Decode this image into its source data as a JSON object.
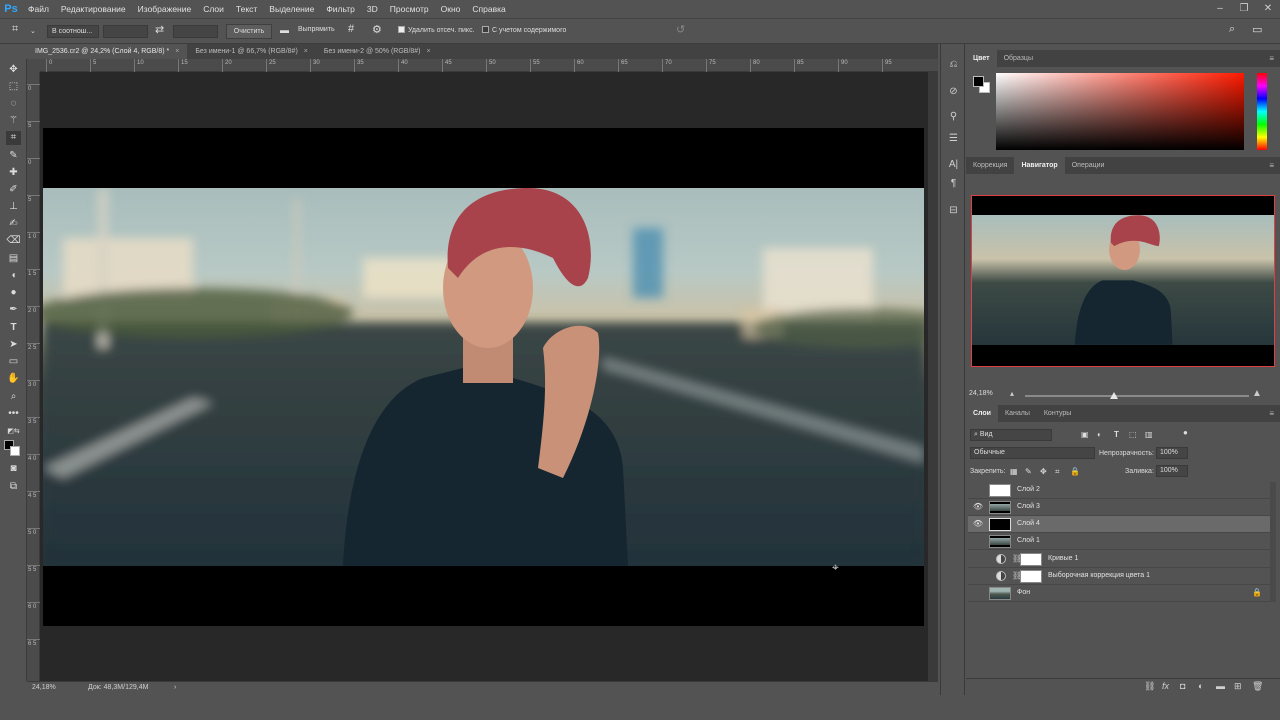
{
  "app": {
    "logo": "Ps"
  },
  "menu": [
    "Файл",
    "Редактирование",
    "Изображение",
    "Слои",
    "Текст",
    "Выделение",
    "Фильтр",
    "3D",
    "Просмотр",
    "Окно",
    "Справка"
  ],
  "options": {
    "ratio_select": "В соотнош...",
    "clear_label": "Очистить",
    "straighten_label": "Выпрямить",
    "delete_cropped_label": "Удалить отсеч. пикс.",
    "content_aware_label": "С учетом содержимого"
  },
  "tabs": [
    {
      "label": "IMG_2536.cr2 @ 24,2% (Слой 4, RGB/8) *",
      "close": "×"
    },
    {
      "label": "Без имени-1 @ 66,7% (RGB/8#)",
      "close": "×"
    },
    {
      "label": "Без имени-2 @ 50% (RGB/8#)",
      "close": "×"
    }
  ],
  "ruler_h": [
    "0",
    "5",
    "10",
    "15",
    "20",
    "25",
    "30",
    "35",
    "40",
    "45",
    "50",
    "55",
    "60",
    "65",
    "70",
    "75",
    "80",
    "85",
    "90",
    "95"
  ],
  "ruler_v": [
    "0",
    "5",
    "0",
    "5",
    "1 0",
    "1 5",
    "2 0",
    "2 5",
    "3 0",
    "3 5",
    "4 0",
    "4 5",
    "5 0",
    "5 5",
    "6 0",
    "6 5"
  ],
  "status": {
    "zoom": "24,18%",
    "doc": "Док: 48,3M/129,4M",
    "arrow": "›"
  },
  "color_panel": {
    "tabs": [
      "Цвет",
      "Образцы"
    ]
  },
  "navigator_panel": {
    "tabs": [
      "Коррекция",
      "Навигатор",
      "Операции"
    ],
    "zoom": "24,18%"
  },
  "layers_panel": {
    "tabs": [
      "Слои",
      "Каналы",
      "Контуры"
    ],
    "filter": "Вид",
    "blend_mode": "Обычные",
    "opacity_label": "Непрозрачность:",
    "opacity_value": "100%",
    "lock_label": "Закрепить:",
    "fill_label": "Заливка:",
    "fill_value": "100%",
    "layers": [
      {
        "name": "Слой 2",
        "visible": false,
        "thumb": "white"
      },
      {
        "name": "Слой 3",
        "visible": true,
        "thumb": "photo"
      },
      {
        "name": "Слой 4",
        "visible": true,
        "thumb": "black",
        "selected": true
      },
      {
        "name": "Слой 1",
        "visible": false,
        "thumb": "photo"
      },
      {
        "name": "Кривые 1",
        "visible": false,
        "thumb": "white",
        "adjustment": true
      },
      {
        "name": "Выборочная коррекция цвета 1",
        "visible": false,
        "thumb": "white",
        "adjustment": true
      },
      {
        "name": "Фон",
        "visible": false,
        "thumb": "photo",
        "locked": true
      }
    ]
  },
  "colors": {
    "accent": "#31a8ff",
    "panel_bg": "#535353",
    "canvas_bg": "#282828",
    "nav_frame": "#e04040",
    "selected_row": "#6a6a6a"
  }
}
